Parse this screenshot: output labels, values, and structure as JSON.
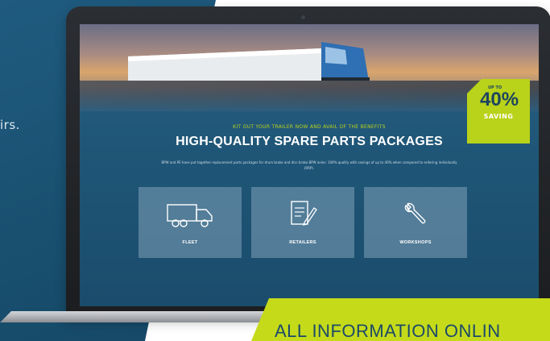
{
  "side_text": "irs.",
  "hero": {
    "badge": {
      "up_to": "UP TO",
      "number": "40%",
      "word": "SAVING"
    }
  },
  "kicker": "KIT OUT YOUR TRAILER NOW AND AVAIL OF THE BENEFITS",
  "headline": "HIGH-QUALITY SPARE PARTS PACKAGES",
  "description": "BPW and PE have put together replacement parts packages for drum brake and disc brake BPW axles: 100% quality with savings of up to 40% when compared to ordering individually (RRP).",
  "tiles": [
    {
      "label": "FLEET",
      "icon": "truck-icon"
    },
    {
      "label": "RETAILERS",
      "icon": "document-pen-icon"
    },
    {
      "label": "WORKSHOPS",
      "icon": "wrench-icon"
    }
  ],
  "banner": {
    "text": "ALL INFORMATION ONLIN"
  },
  "colors": {
    "accent_green": "#c5db1a",
    "dark_blue": "#1f5b7f",
    "text_dark": "#1c4a68"
  }
}
